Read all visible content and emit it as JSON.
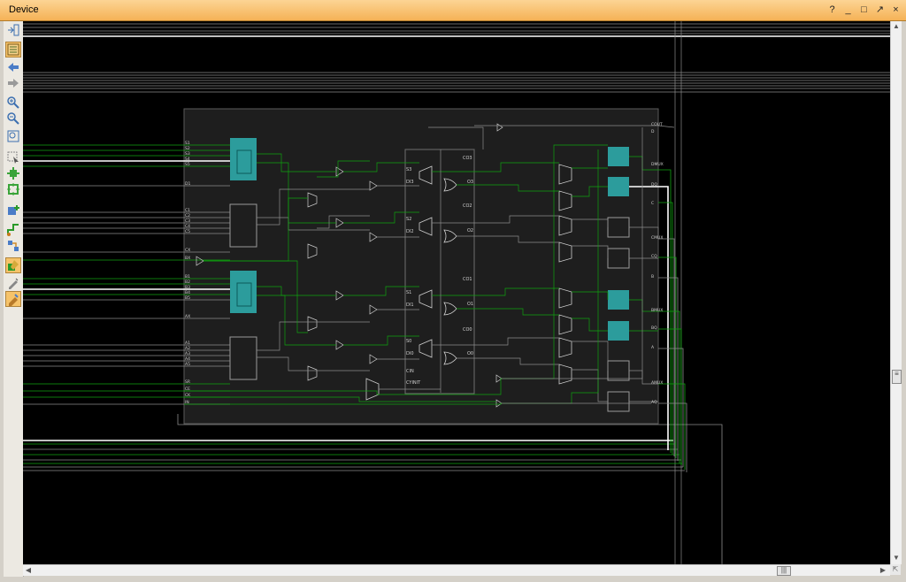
{
  "window": {
    "title": "Device",
    "help": "?",
    "minimize": "_",
    "maximize": "□",
    "restore": "↗",
    "close": "×"
  },
  "toolbar": {
    "icons": [
      "collapse-panel-icon",
      "auto-fit-icon",
      "back-icon",
      "forward-icon",
      "zoom-in-icon",
      "zoom-out-icon",
      "zoom-fit-icon",
      "select-area-icon",
      "expand-selection-icon",
      "fit-selection-icon",
      "add-pblock-icon",
      "route-icon",
      "show-connectivity-icon",
      "highlight-icon",
      "draw-icon",
      "marker-icon"
    ]
  },
  "schematic": {
    "pin_labels_left": [
      "S1",
      "S2",
      "S3",
      "S4",
      "S5",
      "D1",
      "C1",
      "C2",
      "C3",
      "C4",
      "C5",
      "CX",
      "BX",
      "B1",
      "B2",
      "B3",
      "B4",
      "B5",
      "AX",
      "A1",
      "A2",
      "A3",
      "A4",
      "A5",
      "SR",
      "CE",
      "CK",
      "IN"
    ],
    "pin_labels_right": [
      "COUT",
      "D",
      "DMUX",
      "DQ",
      "C",
      "CMUX",
      "CQ",
      "B",
      "BMUX",
      "BQ",
      "A",
      "AMUX",
      "AQ"
    ],
    "middle_labels": [
      "S3",
      "DI3",
      "S2",
      "DI2",
      "S1",
      "DI1",
      "S0",
      "DI0",
      "CIN",
      "CYINIT",
      "CO3",
      "CO2",
      "CO1",
      "CO0",
      "O3",
      "O2",
      "O1",
      "O0"
    ]
  },
  "colors": {
    "accent": "#f5b256",
    "wire_green": "#0fa30f",
    "wire_gray": "#8c8c8c",
    "lut_cyan": "#2fb3b3",
    "slice_bg": "#1e1e1e"
  }
}
